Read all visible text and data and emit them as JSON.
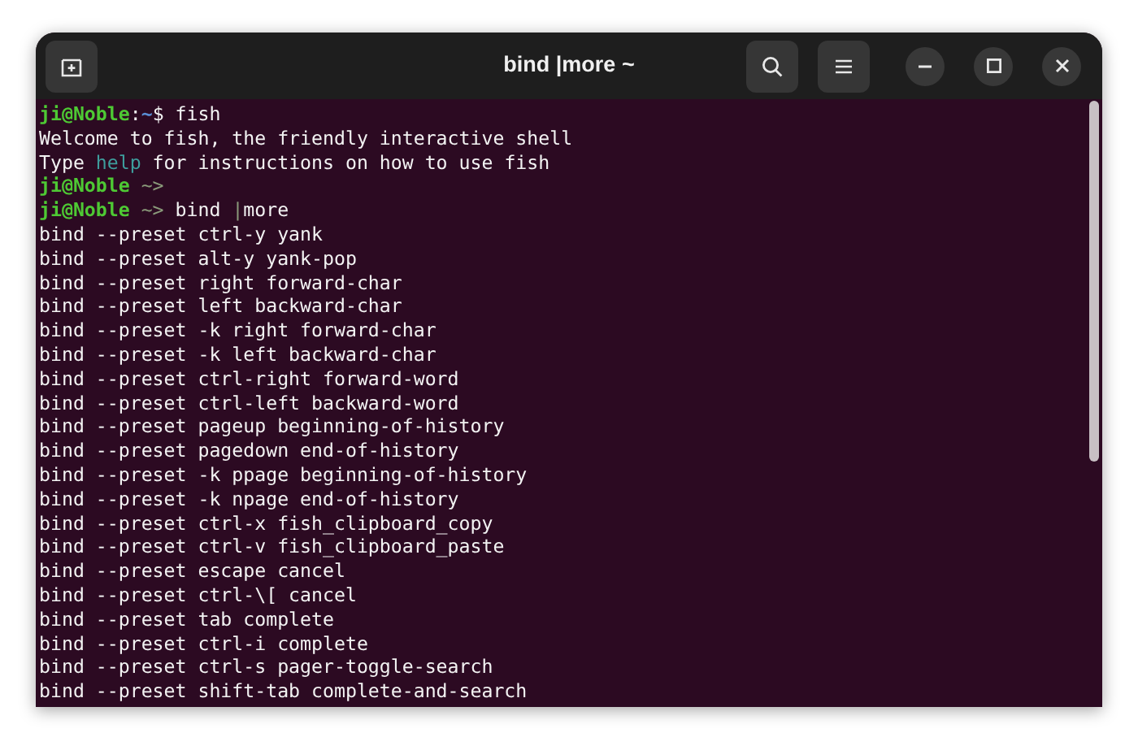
{
  "window": {
    "title": "bind |more ~"
  },
  "terminal": {
    "lines": [
      [
        {
          "text": "ji@Noble",
          "kind": "user"
        },
        {
          "text": ":",
          "kind": "plain"
        },
        {
          "text": "~",
          "kind": "path"
        },
        {
          "text": "$ fish",
          "kind": "plain"
        }
      ],
      [
        {
          "text": "Welcome to fish, the friendly interactive shell",
          "kind": "plain"
        }
      ],
      [
        {
          "text": "Type ",
          "kind": "plain"
        },
        {
          "text": "help",
          "kind": "keyword"
        },
        {
          "text": " for instructions on how to use fish",
          "kind": "plain"
        }
      ],
      [
        {
          "text": "ji@Noble",
          "kind": "user"
        },
        {
          "text": " ~>",
          "kind": "dim"
        }
      ],
      [
        {
          "text": "ji@Noble",
          "kind": "user"
        },
        {
          "text": " ~>",
          "kind": "dim"
        },
        {
          "text": " bind ",
          "kind": "plain"
        },
        {
          "text": "|",
          "kind": "dim"
        },
        {
          "text": "more",
          "kind": "plain"
        }
      ],
      [
        {
          "text": "bind --preset ctrl-y yank",
          "kind": "plain"
        }
      ],
      [
        {
          "text": "bind --preset alt-y yank-pop",
          "kind": "plain"
        }
      ],
      [
        {
          "text": "bind --preset right forward-char",
          "kind": "plain"
        }
      ],
      [
        {
          "text": "bind --preset left backward-char",
          "kind": "plain"
        }
      ],
      [
        {
          "text": "bind --preset -k right forward-char",
          "kind": "plain"
        }
      ],
      [
        {
          "text": "bind --preset -k left backward-char",
          "kind": "plain"
        }
      ],
      [
        {
          "text": "bind --preset ctrl-right forward-word",
          "kind": "plain"
        }
      ],
      [
        {
          "text": "bind --preset ctrl-left backward-word",
          "kind": "plain"
        }
      ],
      [
        {
          "text": "bind --preset pageup beginning-of-history",
          "kind": "plain"
        }
      ],
      [
        {
          "text": "bind --preset pagedown end-of-history",
          "kind": "plain"
        }
      ],
      [
        {
          "text": "bind --preset -k ppage beginning-of-history",
          "kind": "plain"
        }
      ],
      [
        {
          "text": "bind --preset -k npage end-of-history",
          "kind": "plain"
        }
      ],
      [
        {
          "text": "bind --preset ctrl-x fish_clipboard_copy",
          "kind": "plain"
        }
      ],
      [
        {
          "text": "bind --preset ctrl-v fish_clipboard_paste",
          "kind": "plain"
        }
      ],
      [
        {
          "text": "bind --preset escape cancel",
          "kind": "plain"
        }
      ],
      [
        {
          "text": "bind --preset ctrl-\\[ cancel",
          "kind": "plain"
        }
      ],
      [
        {
          "text": "bind --preset tab complete",
          "kind": "plain"
        }
      ],
      [
        {
          "text": "bind --preset ctrl-i complete",
          "kind": "plain"
        }
      ],
      [
        {
          "text": "bind --preset ctrl-s pager-toggle-search",
          "kind": "plain"
        }
      ],
      [
        {
          "text": "bind --preset shift-tab complete-and-search",
          "kind": "plain"
        }
      ]
    ]
  }
}
